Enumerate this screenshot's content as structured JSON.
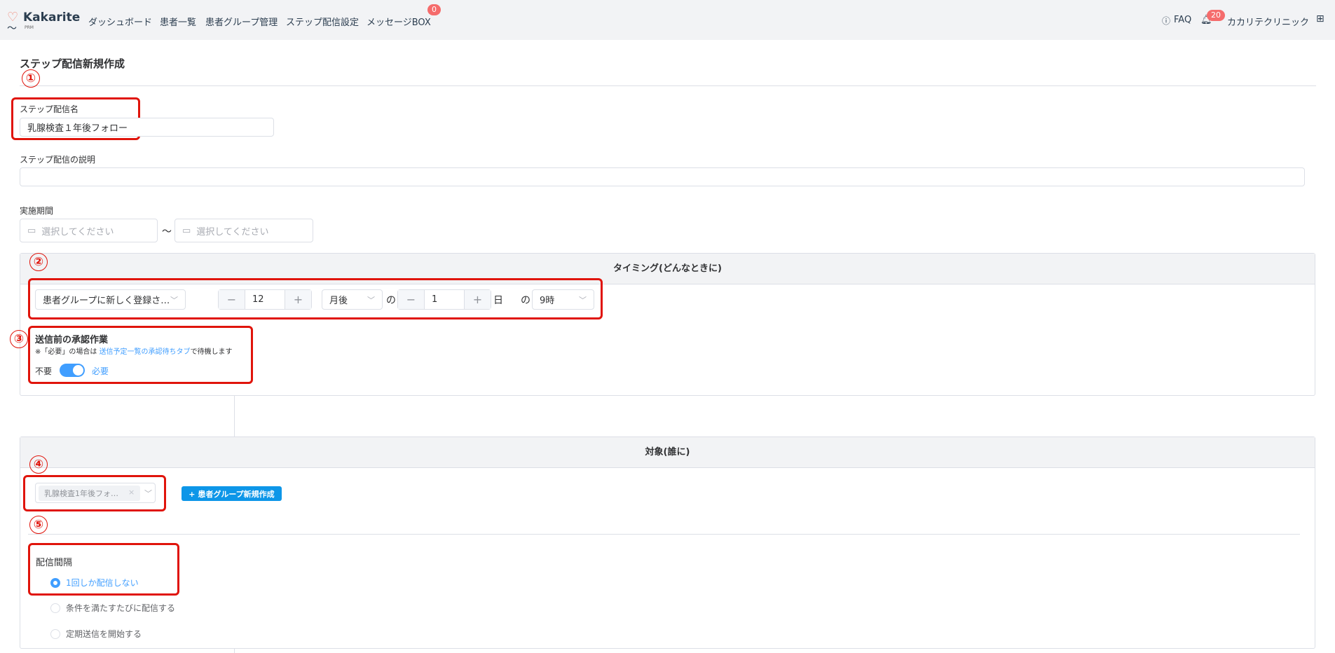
{
  "header": {
    "logo": "Kakarite",
    "logo_sub": "PRM",
    "nav": [
      "ダッシュボード",
      "患者一覧",
      "患者グループ管理",
      "ステップ配信設定",
      "メッセージBOX"
    ],
    "message_badge": "0",
    "faq": "FAQ",
    "notification_badge": "20",
    "clinic": "カカリテクリニック"
  },
  "page": {
    "title": "ステップ配信新規作成"
  },
  "annotations": [
    "①",
    "②",
    "③",
    "④",
    "⑤"
  ],
  "form": {
    "name_label": "ステップ配信名",
    "name_value": "乳腺検査１年後フォロー",
    "desc_label": "ステップ配信の説明",
    "desc_value": "",
    "period_label": "実施期間",
    "date_placeholder": "選択してください",
    "tilde": "〜"
  },
  "timing": {
    "title": "タイミング(どんなときに)",
    "trigger": "患者グループに新しく登録さ…",
    "count": "12",
    "unit": "月後",
    "no1": "の",
    "day": "1",
    "day_suffix": "日",
    "no2": "の",
    "hour": "9時",
    "approval_title": "送信前の承認作業",
    "note_prefix": "※「必要」の場合は ",
    "note_link": "送信予定一覧の承認待ちタブ",
    "note_suffix": "で待機します",
    "off_label": "不要",
    "on_label": "必要",
    "approval_required": true
  },
  "target": {
    "title": "対象(誰に)",
    "group_tag": "乳腺検査1年後フォ…",
    "new_group_button": "+ 患者グループ新規作成",
    "interval_label": "配信間隔",
    "options": [
      "1回しか配信しない",
      "条件を満たすたびに配信する",
      "定期送信を開始する"
    ],
    "selected": 0
  },
  "colors": {
    "primary": "#409eff",
    "annotation": "#e0140b",
    "badge": "#f56c6c"
  }
}
